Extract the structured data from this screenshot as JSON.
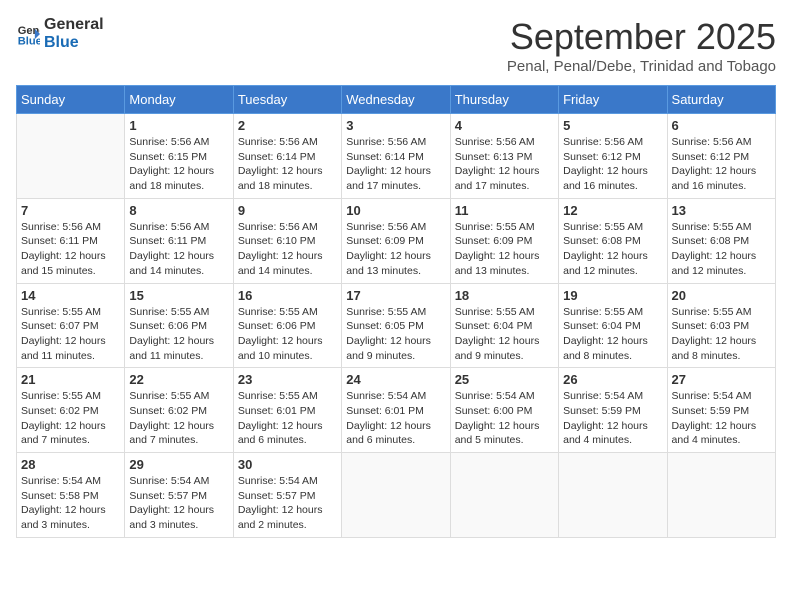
{
  "logo": {
    "text_general": "General",
    "text_blue": "Blue",
    "arrow_color": "#3a78c9"
  },
  "header": {
    "month_title": "September 2025",
    "subtitle": "Penal, Penal/Debe, Trinidad and Tobago"
  },
  "days_of_week": [
    "Sunday",
    "Monday",
    "Tuesday",
    "Wednesday",
    "Thursday",
    "Friday",
    "Saturday"
  ],
  "weeks": [
    [
      {
        "day": "",
        "info": ""
      },
      {
        "day": "1",
        "info": "Sunrise: 5:56 AM\nSunset: 6:15 PM\nDaylight: 12 hours\nand 18 minutes."
      },
      {
        "day": "2",
        "info": "Sunrise: 5:56 AM\nSunset: 6:14 PM\nDaylight: 12 hours\nand 18 minutes."
      },
      {
        "day": "3",
        "info": "Sunrise: 5:56 AM\nSunset: 6:14 PM\nDaylight: 12 hours\nand 17 minutes."
      },
      {
        "day": "4",
        "info": "Sunrise: 5:56 AM\nSunset: 6:13 PM\nDaylight: 12 hours\nand 17 minutes."
      },
      {
        "day": "5",
        "info": "Sunrise: 5:56 AM\nSunset: 6:12 PM\nDaylight: 12 hours\nand 16 minutes."
      },
      {
        "day": "6",
        "info": "Sunrise: 5:56 AM\nSunset: 6:12 PM\nDaylight: 12 hours\nand 16 minutes."
      }
    ],
    [
      {
        "day": "7",
        "info": "Sunrise: 5:56 AM\nSunset: 6:11 PM\nDaylight: 12 hours\nand 15 minutes."
      },
      {
        "day": "8",
        "info": "Sunrise: 5:56 AM\nSunset: 6:11 PM\nDaylight: 12 hours\nand 14 minutes."
      },
      {
        "day": "9",
        "info": "Sunrise: 5:56 AM\nSunset: 6:10 PM\nDaylight: 12 hours\nand 14 minutes."
      },
      {
        "day": "10",
        "info": "Sunrise: 5:56 AM\nSunset: 6:09 PM\nDaylight: 12 hours\nand 13 minutes."
      },
      {
        "day": "11",
        "info": "Sunrise: 5:55 AM\nSunset: 6:09 PM\nDaylight: 12 hours\nand 13 minutes."
      },
      {
        "day": "12",
        "info": "Sunrise: 5:55 AM\nSunset: 6:08 PM\nDaylight: 12 hours\nand 12 minutes."
      },
      {
        "day": "13",
        "info": "Sunrise: 5:55 AM\nSunset: 6:08 PM\nDaylight: 12 hours\nand 12 minutes."
      }
    ],
    [
      {
        "day": "14",
        "info": "Sunrise: 5:55 AM\nSunset: 6:07 PM\nDaylight: 12 hours\nand 11 minutes."
      },
      {
        "day": "15",
        "info": "Sunrise: 5:55 AM\nSunset: 6:06 PM\nDaylight: 12 hours\nand 11 minutes."
      },
      {
        "day": "16",
        "info": "Sunrise: 5:55 AM\nSunset: 6:06 PM\nDaylight: 12 hours\nand 10 minutes."
      },
      {
        "day": "17",
        "info": "Sunrise: 5:55 AM\nSunset: 6:05 PM\nDaylight: 12 hours\nand 9 minutes."
      },
      {
        "day": "18",
        "info": "Sunrise: 5:55 AM\nSunset: 6:04 PM\nDaylight: 12 hours\nand 9 minutes."
      },
      {
        "day": "19",
        "info": "Sunrise: 5:55 AM\nSunset: 6:04 PM\nDaylight: 12 hours\nand 8 minutes."
      },
      {
        "day": "20",
        "info": "Sunrise: 5:55 AM\nSunset: 6:03 PM\nDaylight: 12 hours\nand 8 minutes."
      }
    ],
    [
      {
        "day": "21",
        "info": "Sunrise: 5:55 AM\nSunset: 6:02 PM\nDaylight: 12 hours\nand 7 minutes."
      },
      {
        "day": "22",
        "info": "Sunrise: 5:55 AM\nSunset: 6:02 PM\nDaylight: 12 hours\nand 7 minutes."
      },
      {
        "day": "23",
        "info": "Sunrise: 5:55 AM\nSunset: 6:01 PM\nDaylight: 12 hours\nand 6 minutes."
      },
      {
        "day": "24",
        "info": "Sunrise: 5:54 AM\nSunset: 6:01 PM\nDaylight: 12 hours\nand 6 minutes."
      },
      {
        "day": "25",
        "info": "Sunrise: 5:54 AM\nSunset: 6:00 PM\nDaylight: 12 hours\nand 5 minutes."
      },
      {
        "day": "26",
        "info": "Sunrise: 5:54 AM\nSunset: 5:59 PM\nDaylight: 12 hours\nand 4 minutes."
      },
      {
        "day": "27",
        "info": "Sunrise: 5:54 AM\nSunset: 5:59 PM\nDaylight: 12 hours\nand 4 minutes."
      }
    ],
    [
      {
        "day": "28",
        "info": "Sunrise: 5:54 AM\nSunset: 5:58 PM\nDaylight: 12 hours\nand 3 minutes."
      },
      {
        "day": "29",
        "info": "Sunrise: 5:54 AM\nSunset: 5:57 PM\nDaylight: 12 hours\nand 3 minutes."
      },
      {
        "day": "30",
        "info": "Sunrise: 5:54 AM\nSunset: 5:57 PM\nDaylight: 12 hours\nand 2 minutes."
      },
      {
        "day": "",
        "info": ""
      },
      {
        "day": "",
        "info": ""
      },
      {
        "day": "",
        "info": ""
      },
      {
        "day": "",
        "info": ""
      }
    ]
  ]
}
